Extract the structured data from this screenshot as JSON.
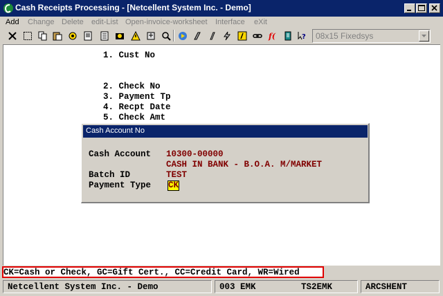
{
  "window": {
    "title": "Cash Receipts Processing - [Netcellent System Inc. - Demo]"
  },
  "menu": {
    "items": [
      {
        "label": "Add",
        "enabled": true
      },
      {
        "label": "Change",
        "enabled": false
      },
      {
        "label": "Delete",
        "enabled": false
      },
      {
        "label": "edit-List",
        "enabled": false
      },
      {
        "label": "Open-invoice-worksheet",
        "enabled": false
      },
      {
        "label": "Interface",
        "enabled": false
      },
      {
        "label": "eXit",
        "enabled": false
      }
    ]
  },
  "toolbar": {
    "font_value": "08x15 Fixedsys",
    "icons": [
      "close-x-icon",
      "select-icon",
      "copy-icon",
      "paste-icon",
      "settings-icon",
      "page-icon",
      "list-icon",
      "database-icon",
      "warning-icon",
      "zoom-icon",
      "search-icon",
      "run-icon",
      "script-icon",
      "text-icon",
      "lightning-icon",
      "function-icon",
      "link-icon",
      "fx-icon",
      "book-icon",
      "help-icon"
    ]
  },
  "screen": {
    "fields": [
      {
        "label": "1. Cust No"
      },
      {
        "label": "2. Check No"
      },
      {
        "label": "3. Payment Tp"
      },
      {
        "label": "4. Recpt Date"
      },
      {
        "label": "5. Check Amt"
      }
    ]
  },
  "dialog": {
    "title": "Cash Account No",
    "cash_account_label": "Cash Account",
    "cash_account_value": "10300-00000",
    "cash_account_desc": "CASH IN BANK - B.O.A. M/MARKET",
    "batch_id_label": "Batch ID",
    "batch_id_value": "TEST",
    "payment_type_label": "Payment Type",
    "payment_type_value": "CK"
  },
  "help_line": "CK=Cash or Check, GC=Gift Cert., CC=Credit Card, WR=Wired",
  "status_bar": {
    "company": "Netcellent System Inc. - Demo",
    "company_code": "003 EMK",
    "terminal": "TS2EMK",
    "module": "ARCSHENT"
  },
  "colors": {
    "title_bar": "#0a246a",
    "value_text": "#800000",
    "input_highlight": "#ffff00",
    "help_border": "#e00000"
  }
}
